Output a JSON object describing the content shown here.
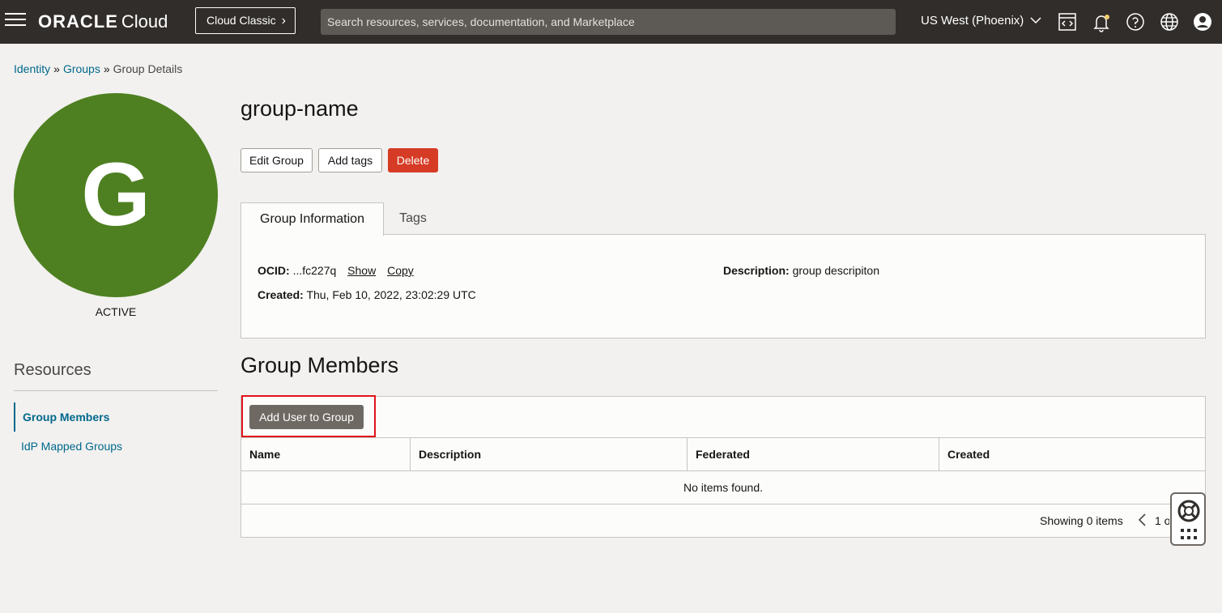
{
  "topbar": {
    "brand_oracle": "ORACLE",
    "brand_cloud": "Cloud",
    "cloud_classic_label": "Cloud Classic",
    "search_placeholder": "Search resources, services, documentation, and Marketplace",
    "region": "US West (Phoenix)",
    "icons": [
      "menu-icon",
      "code-editor-icon",
      "notifications-icon",
      "help-icon",
      "language-icon",
      "profile-icon"
    ]
  },
  "breadcrumb": {
    "items": [
      "Identity",
      "Groups"
    ],
    "separator": "»",
    "current": "Group Details"
  },
  "group": {
    "avatar_letter": "G",
    "avatar_color": "#4e8021",
    "status": "ACTIVE",
    "name": "group-name"
  },
  "actions": {
    "edit_label": "Edit Group",
    "tags_label": "Add tags",
    "delete_label": "Delete"
  },
  "tabs": [
    {
      "label": "Group Information",
      "active": true
    },
    {
      "label": "Tags",
      "active": false
    }
  ],
  "info": {
    "ocid_label": "OCID:",
    "ocid_value": "...fc227q",
    "show_label": "Show",
    "copy_label": "Copy",
    "created_label": "Created:",
    "created_value": "Thu, Feb 10, 2022, 23:02:29 UTC",
    "description_label": "Description:",
    "description_value": "group descripiton"
  },
  "resources": {
    "heading": "Resources",
    "items": [
      {
        "label": "Group Members",
        "active": true
      },
      {
        "label": "IdP Mapped Groups",
        "active": false
      }
    ]
  },
  "members": {
    "title": "Group Members",
    "add_button_label": "Add User to Group",
    "columns": [
      "Name",
      "Description",
      "Federated",
      "Created"
    ],
    "empty_text": "No items found.",
    "showing_text": "Showing 0 items",
    "page_text": "1 of 1"
  },
  "colors": {
    "topbar": "#312d2a",
    "link": "#00688c",
    "danger": "#d63b25",
    "highlight": "#e0131a"
  }
}
